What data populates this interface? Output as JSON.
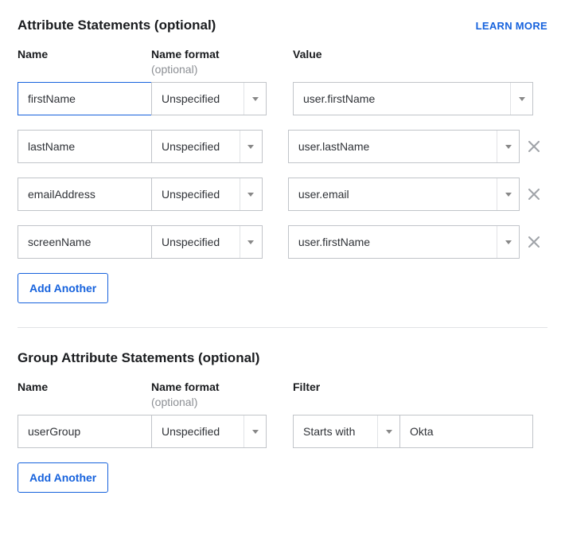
{
  "sections": {
    "attr": {
      "title": "Attribute Statements (optional)",
      "learn_more": "LEARN MORE",
      "headers": {
        "name": "Name",
        "format": "Name format",
        "format_sub": "(optional)",
        "value": "Value"
      },
      "rows": [
        {
          "name": "firstName",
          "format": "Unspecified",
          "value": "user.firstName",
          "focused": true,
          "removable": false
        },
        {
          "name": "lastName",
          "format": "Unspecified",
          "value": "user.lastName",
          "focused": false,
          "removable": true
        },
        {
          "name": "emailAddress",
          "format": "Unspecified",
          "value": "user.email",
          "focused": false,
          "removable": true
        },
        {
          "name": "screenName",
          "format": "Unspecified",
          "value": "user.firstName",
          "focused": false,
          "removable": true
        }
      ],
      "add_label": "Add Another"
    },
    "group": {
      "title": "Group Attribute Statements (optional)",
      "headers": {
        "name": "Name",
        "format": "Name format",
        "format_sub": "(optional)",
        "filter": "Filter"
      },
      "rows": [
        {
          "name": "userGroup",
          "format": "Unspecified",
          "filter_op": "Starts with",
          "filter_val": "Okta"
        }
      ],
      "add_label": "Add Another"
    }
  }
}
